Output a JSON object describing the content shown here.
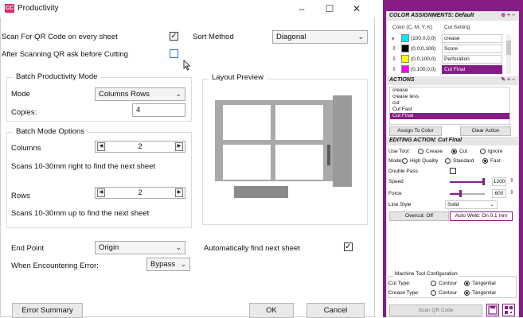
{
  "window": {
    "title": "Productivity",
    "logo": "CC",
    "minimize": "–",
    "maximize": "☐",
    "close": "✕"
  },
  "scan_qr": {
    "label": "Scan For QR Code on every sheet",
    "checked": "✓"
  },
  "after_scan": {
    "label": "After Scanning QR ask before Cutting",
    "checked": ""
  },
  "sort": {
    "label": "Sort Method",
    "value": "Diagonal"
  },
  "batch_mode": {
    "legend": "Batch Productivity Mode",
    "mode_label": "Mode",
    "mode_value": "Columns  Rows",
    "copies_label": "Copies:",
    "copies_value": "4"
  },
  "batch_options": {
    "legend": "Batch Mode Options",
    "columns_label": "Columns",
    "columns_value": "2",
    "columns_hint": "Scans 10-30mm right to find the next sheet",
    "rows_label": "Rows",
    "rows_value": "2",
    "rows_hint": "Scans 10-30mm up to find the next sheet"
  },
  "layout_preview": {
    "legend": "Layout Preview"
  },
  "end_point": {
    "label": "End Point",
    "value": "Origin"
  },
  "auto_find": {
    "label": "Automatically find next sheet",
    "checked": "✓"
  },
  "error_mode": {
    "label": "When Encountering Error:",
    "value": "Bypass"
  },
  "footer": {
    "error_summary": "Error Summary",
    "ok": "OK",
    "cancel": "Cancel"
  },
  "panel": {
    "color_assign": {
      "title": "COLOR ASSIGNMENTS: Default",
      "controls": "⊕ + –"
    },
    "columns": {
      "cmyk": "Color (C, M, Y, K)",
      "setting": "Cut Setting"
    },
    "color_rows": [
      {
        "cmyk": "(100,0,0,0)",
        "setting": "crease",
        "color": "#00e5ff"
      },
      {
        "cmyk": "(0,0,0,100)",
        "setting": "Score",
        "color": "#000000"
      },
      {
        "cmyk": "(0,0,100,0)",
        "setting": "Perforation",
        "color": "#ffff00"
      },
      {
        "cmyk": "(0,100,0,0)",
        "setting": "Cut Final",
        "color": "#ff00ff"
      }
    ],
    "actions": {
      "title": "ACTIONS",
      "controls": "✎ + –",
      "items": [
        "crease",
        "crease less",
        "cut",
        "Cut Fast",
        "Cut Final"
      ],
      "assign": "Assign To Color",
      "clear": "Clear Action"
    },
    "editing": {
      "title": "EDITING ACTION: Cut Final",
      "tool_label": "Use Tool:",
      "tool_options": [
        "Crease",
        "Cut",
        "Ignore"
      ],
      "mode_label": "Mode:",
      "mode_options": [
        "High Quality",
        "Standard",
        "Fast"
      ],
      "double_pass": "Double Pass",
      "speed_label": "Speed",
      "speed_value": "1200",
      "force_label": "Force",
      "force_value": "600",
      "line_style_label": "Line Style",
      "line_style_value": "Solid",
      "overcut": "Overcut: Off",
      "autoweld": "Auto Weld: On 0.1 mm"
    },
    "machine": {
      "legend": "Machine Tool Configuration",
      "cut_type_label": "Cut Type:",
      "crease_type_label": "Crease Type:",
      "contour": "Contour",
      "tangential": "Tangential"
    },
    "scan_qr_button": "Scan QR Code"
  },
  "colors": {
    "accent": "#861d86",
    "logo": "#d62d6e"
  }
}
